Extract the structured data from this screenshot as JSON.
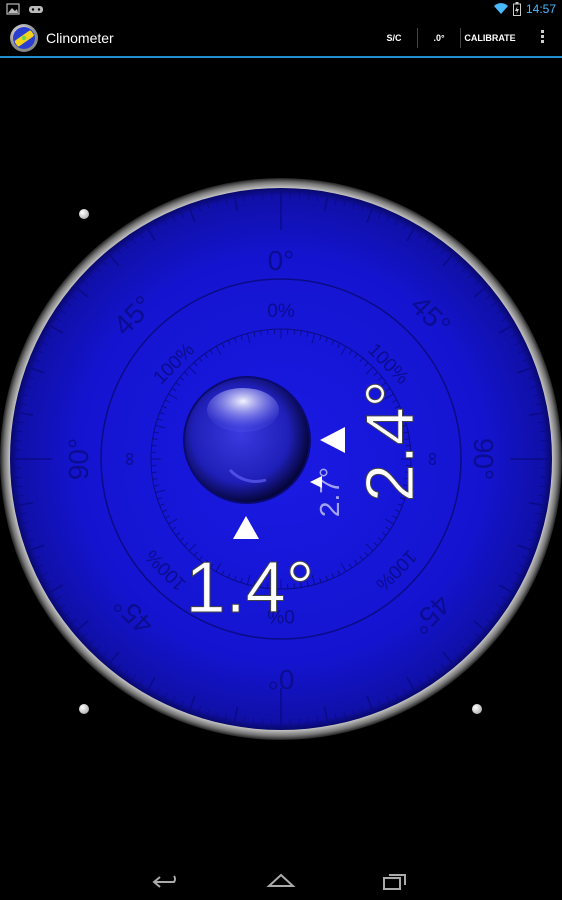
{
  "status_bar": {
    "time": "14:57"
  },
  "action_bar": {
    "title": "Clinometer",
    "buttons": {
      "sc": "S/C",
      "decimal": ".0°",
      "calibrate": "CALIBRATE"
    }
  },
  "dial": {
    "outer_labels": {
      "top": "0°",
      "right": "90°",
      "bottom": "0°",
      "left": "90°",
      "top_left": "45°",
      "top_right": "45°",
      "bottom_left": "45°",
      "bottom_right": "45°"
    },
    "inner_labels": {
      "top": "0%",
      "bottom": "0%",
      "left": "∞",
      "right": "∞",
      "top_left": "100%",
      "top_right": "100%",
      "bottom_left": "100%",
      "bottom_right": "100%"
    },
    "readings": {
      "horizontal": "1.4°",
      "vertical": "2.4°",
      "secondary": "2.7°"
    }
  },
  "colors": {
    "dial": "#1414d8",
    "accent": "#1f8fcf",
    "status": "#4ab8ff"
  },
  "icons": [
    "gallery-icon",
    "game-icon",
    "wifi-icon",
    "battery-icon",
    "overflow-menu-icon",
    "back-icon",
    "home-icon",
    "recents-icon",
    "lock-icon"
  ]
}
